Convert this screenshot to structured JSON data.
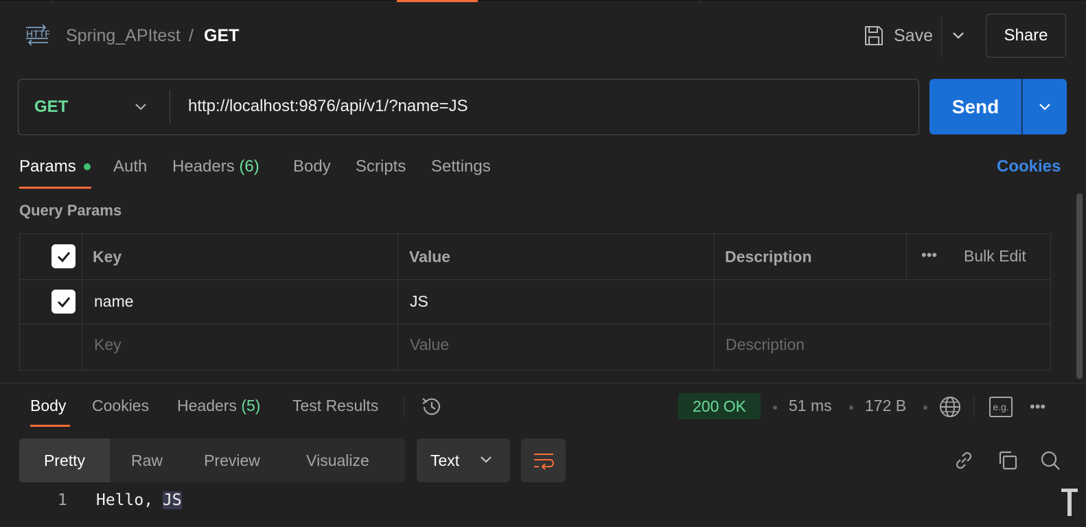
{
  "header": {
    "collection": "Spring_APItest",
    "separator": "/",
    "request_name": "GET",
    "save_label": "Save",
    "share_label": "Share",
    "http_icon_text": "HTTP"
  },
  "request": {
    "method": "GET",
    "url": "http://localhost:9876/api/v1/?name=JS",
    "send_label": "Send"
  },
  "request_tabs": {
    "params": "Params",
    "auth": "Auth",
    "headers": "Headers",
    "headers_count": "(6)",
    "body": "Body",
    "scripts": "Scripts",
    "settings": "Settings",
    "cookies": "Cookies"
  },
  "query_params": {
    "title": "Query Params",
    "columns": {
      "key": "Key",
      "value": "Value",
      "description": "Description",
      "bulk_edit": "Bulk Edit"
    },
    "rows": [
      {
        "enabled": true,
        "key": "name",
        "value": "JS",
        "description": ""
      }
    ],
    "placeholders": {
      "key": "Key",
      "value": "Value",
      "description": "Description"
    }
  },
  "response_tabs": {
    "body": "Body",
    "cookies": "Cookies",
    "headers": "Headers",
    "headers_count": "(5)",
    "test_results": "Test Results"
  },
  "response_meta": {
    "status": "200 OK",
    "time": "51 ms",
    "size": "172 B",
    "eg_label": "e.g."
  },
  "view_modes": {
    "pretty": "Pretty",
    "raw": "Raw",
    "preview": "Preview",
    "visualize": "Visualize",
    "format": "Text"
  },
  "editor": {
    "line_number": "1",
    "code_prefix": "Hello, ",
    "code_highlight": "JS"
  },
  "colors": {
    "accent": "#ff6c37",
    "send": "#1a6fd6",
    "method_get": "#6bdd9a",
    "link": "#3b86e8",
    "background": "#212121"
  }
}
